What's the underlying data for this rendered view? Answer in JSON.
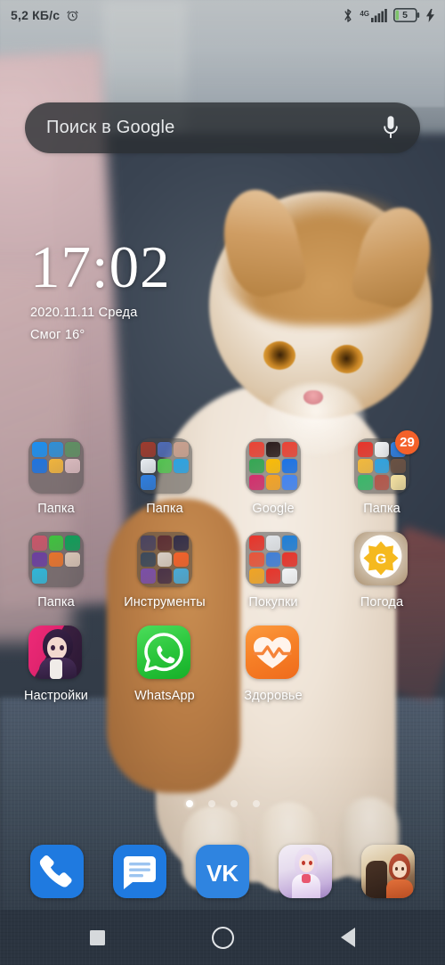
{
  "status_bar": {
    "network_speed": "5,2 КБ/с",
    "alarm_icon": "alarm-clock-icon",
    "bluetooth_icon": "bluetooth-icon",
    "network_type": "4G",
    "signal_icon": "signal-bars-icon",
    "battery_level": "5",
    "charging_icon": "charging-bolt-icon",
    "battery_color": "#7ec46a",
    "text_color": "#33383c"
  },
  "search": {
    "placeholder": "Поиск в Google",
    "mic_icon": "microphone-icon",
    "background": "rgba(42,46,50,0.80)"
  },
  "clock_widget": {
    "time": "17:02",
    "date": "2020.11.11  Среда",
    "weather": "Смог 16°"
  },
  "app_grid": {
    "rows": [
      [
        {
          "label": "Папка",
          "type": "folder",
          "name": "folder-papka-1",
          "badge": null,
          "mini_colors": [
            "#1b8ff0",
            "#2f8fd6",
            "#5e8f62",
            "#1e74e0",
            "#f0b43c",
            "#d8b9bd",
            "",
            "",
            ""
          ]
        },
        {
          "label": "Папка",
          "type": "folder",
          "name": "folder-papka-2",
          "badge": null,
          "mini_colors": [
            "#9e3b2e",
            "#4f6bb5",
            "#c9a08e",
            "#e9edf2",
            "#55c552",
            "#2ba3e3",
            "#2f7fe0",
            "",
            ""
          ]
        },
        {
          "label": "Google",
          "type": "folder",
          "name": "folder-google",
          "badge": null,
          "mini_colors": [
            "#ea4335",
            "#2b1c1c",
            "#ea4335",
            "#34a853",
            "#fbbc05",
            "#1a73e8",
            "#d32f6d",
            "#f4a324",
            "#4285f4"
          ]
        },
        {
          "label": "Папка",
          "type": "folder",
          "name": "folder-papka-3",
          "badge": "29",
          "mini_colors": [
            "#e8342a",
            "#f1f3f5",
            "#2f7fe0",
            "#f2b93c",
            "#2fa3e0",
            "#6b5243",
            "#39b86a",
            "#b4564a",
            "#f3e0a0"
          ]
        }
      ],
      [
        {
          "label": "Папка",
          "type": "folder",
          "name": "folder-papka-4",
          "badge": null,
          "mini_colors": [
            "#c9566a",
            "#3ec23e",
            "#0f9d58",
            "#6b3fa0",
            "#e8732a",
            "#d7c3b4",
            "#2fb6d8",
            "",
            ""
          ]
        },
        {
          "label": "Инструменты",
          "type": "folder",
          "name": "folder-instrumenty",
          "badge": null,
          "mini_colors": [
            "#4a4460",
            "#5c2f35",
            "#332f4a",
            "#3c4a5c",
            "#d8cfc6",
            "#f2622a",
            "#7b4fa8",
            "#4a3348",
            "#49a9d6"
          ]
        },
        {
          "label": "Покупки",
          "type": "folder",
          "name": "folder-pokupki",
          "badge": null,
          "mini_colors": [
            "#e8342a",
            "#e0e4e8",
            "#1e7fd8",
            "#e8553a",
            "#3f7fd8",
            "#e8342a",
            "#f0a424",
            "#e8342a",
            "#f2f4f6"
          ]
        },
        {
          "label": "Погода",
          "type": "app",
          "name": "app-pogoda",
          "icon": "weather-sun-icon",
          "badge": null
        }
      ],
      [
        {
          "label": "Настройки",
          "type": "app",
          "name": "app-nastroyki",
          "icon": "anime-character-icon",
          "badge": null
        },
        {
          "label": "WhatsApp",
          "type": "app",
          "name": "app-whatsapp",
          "icon": "whatsapp-icon",
          "badge": null
        },
        {
          "label": "Здоровье",
          "type": "app",
          "name": "app-zdorovye",
          "icon": "health-heart-icon",
          "badge": null
        }
      ]
    ]
  },
  "page_indicator": {
    "total": 4,
    "active_index": 0
  },
  "dock": {
    "items": [
      {
        "name": "dock-phone",
        "icon": "phone-icon"
      },
      {
        "name": "dock-messages",
        "icon": "messages-icon"
      },
      {
        "name": "dock-vk",
        "icon": "vk-icon"
      },
      {
        "name": "dock-game-1",
        "icon": "anime-game-icon"
      },
      {
        "name": "dock-game-2",
        "icon": "anime-game-icon-2"
      }
    ]
  },
  "nav_bar": {
    "recents": "recents-square-icon",
    "home": "home-circle-icon",
    "back": "back-triangle-icon",
    "background": "#2b3440"
  }
}
